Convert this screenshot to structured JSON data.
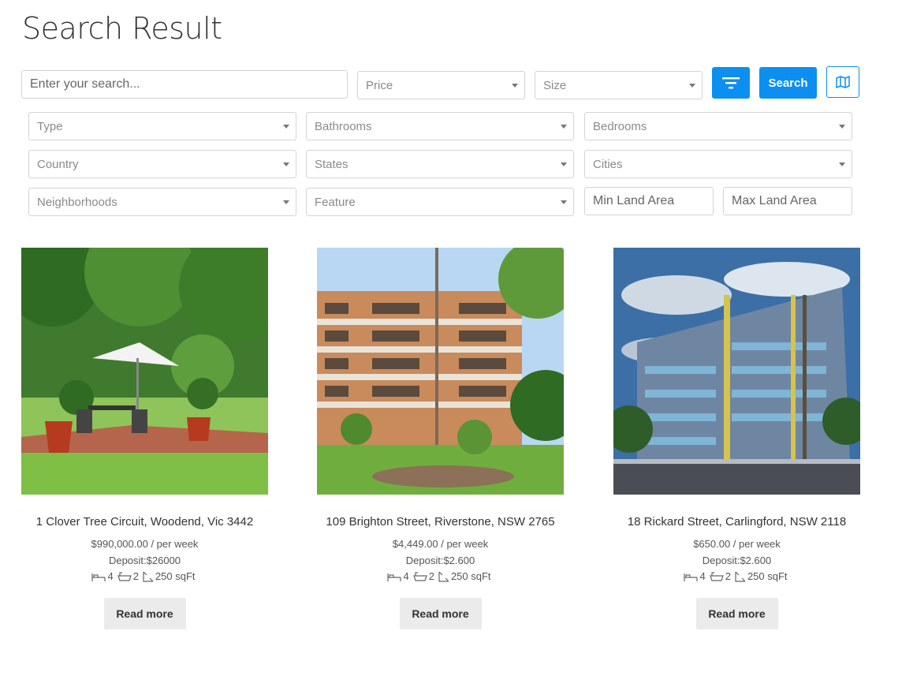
{
  "page": {
    "title": "Search Result"
  },
  "search": {
    "placeholder": "Enter your search...",
    "price_label": "Price",
    "size_label": "Size",
    "search_button": "Search"
  },
  "filters": {
    "type": "Type",
    "bathrooms": "Bathrooms",
    "bedrooms": "Bedrooms",
    "country": "Country",
    "states": "States",
    "cities": "Cities",
    "neighborhoods": "Neighborhoods",
    "feature": "Feature",
    "min_land_area": "Min Land Area",
    "max_land_area": "Max Land Area"
  },
  "listings": [
    {
      "address": "1 Clover Tree Circuit, Woodend, Vic 3442",
      "price": "$990,000.00 / per week",
      "deposit": "Deposit:$26000",
      "beds": "4",
      "baths": "2",
      "area": "250 sqFt",
      "read_more": "Read more",
      "photo": "garden-patio-umbrella"
    },
    {
      "address": "109 Brighton Street, Riverstone, NSW 2765",
      "price": "$4,449.00 / per week",
      "deposit": "Deposit:$2.600",
      "beds": "4",
      "baths": "2",
      "area": "250 sqFt",
      "read_more": "Read more",
      "photo": "brick-apartment-tree"
    },
    {
      "address": "18 Rickard Street, Carlingford, NSW 2118",
      "price": "$650.00 / per week",
      "deposit": "Deposit:$2.600",
      "beds": "4",
      "baths": "2",
      "area": "250 sqFt",
      "read_more": "Read more",
      "photo": "modern-apartment-building"
    }
  ],
  "colors": {
    "accent": "#0c8ff0",
    "read_more_bg": "#ebebeb"
  }
}
